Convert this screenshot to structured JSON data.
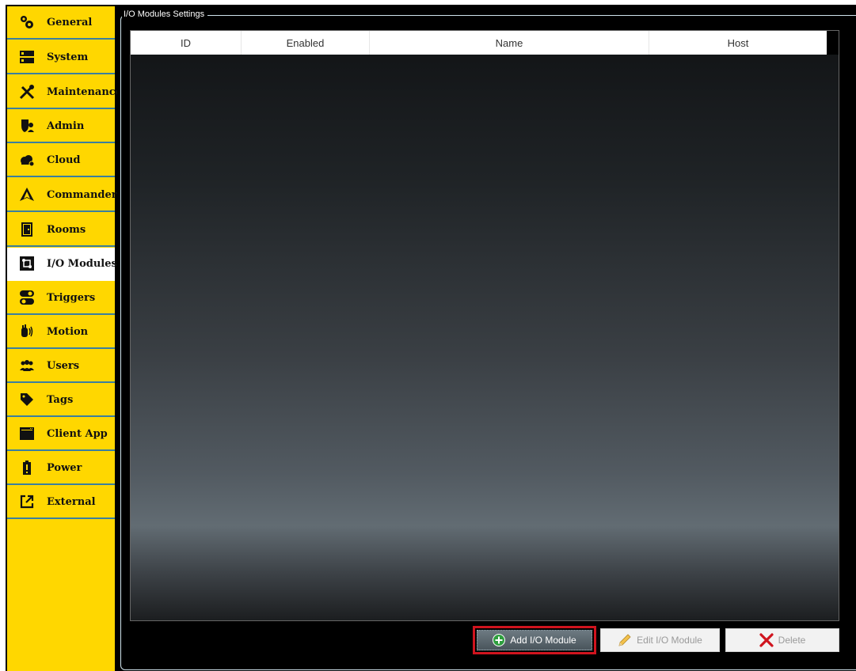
{
  "sidebar": {
    "items": [
      {
        "label": "General",
        "icon": "gears-icon"
      },
      {
        "label": "System",
        "icon": "server-icon"
      },
      {
        "label": "Maintenance",
        "icon": "tools-icon"
      },
      {
        "label": "Admin",
        "icon": "admin-shield-icon"
      },
      {
        "label": "Cloud",
        "icon": "cloud-icon"
      },
      {
        "label": "Commander",
        "icon": "commander-icon"
      },
      {
        "label": "Rooms",
        "icon": "door-icon"
      },
      {
        "label": "I/O Modules",
        "icon": "io-module-icon",
        "active": true
      },
      {
        "label": "Triggers",
        "icon": "toggle-icon"
      },
      {
        "label": "Motion",
        "icon": "motion-hand-icon"
      },
      {
        "label": "Users",
        "icon": "users-icon"
      },
      {
        "label": "Tags",
        "icon": "tag-icon"
      },
      {
        "label": "Client App",
        "icon": "app-window-icon"
      },
      {
        "label": "Power",
        "icon": "battery-icon"
      },
      {
        "label": "External",
        "icon": "external-link-icon"
      }
    ]
  },
  "main": {
    "group_title": "I/O Modules Settings",
    "columns": [
      "ID",
      "Enabled",
      "Name",
      "Host"
    ],
    "rows": []
  },
  "buttons": {
    "add": "Add I/O Module",
    "edit": "Edit I/O Module",
    "delete": "Delete"
  },
  "colors": {
    "sidebar_bg": "#FFD700",
    "highlight": "#D0141E",
    "add_icon": "#2E9E3E",
    "delete_icon": "#D0141E"
  }
}
